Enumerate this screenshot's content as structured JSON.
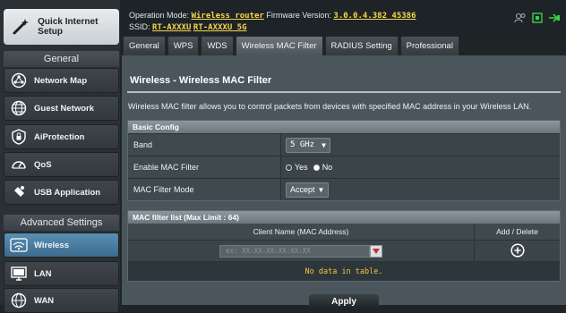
{
  "sidebar": {
    "quick_setup": "Quick Internet Setup",
    "general_label": "General",
    "general_items": [
      {
        "label": "Network Map",
        "icon": "network-map-icon"
      },
      {
        "label": "Guest Network",
        "icon": "guest-network-icon"
      },
      {
        "label": "AiProtection",
        "icon": "shield-lock-icon"
      },
      {
        "label": "QoS",
        "icon": "speedometer-icon"
      },
      {
        "label": "USB Application",
        "icon": "puzzle-icon"
      }
    ],
    "advanced_label": "Advanced Settings",
    "advanced_items": [
      {
        "label": "Wireless",
        "icon": "wifi-icon",
        "active": true
      },
      {
        "label": "LAN",
        "icon": "monitor-icon"
      },
      {
        "label": "WAN",
        "icon": "globe-icon"
      }
    ]
  },
  "header": {
    "op_mode_label": "Operation Mode:",
    "op_mode_value": "Wireless router",
    "fw_label": "Firmware Version:",
    "fw_value": "3.0.0.4.382_45386",
    "ssid_label": "SSID:",
    "ssid_1": "RT-AXXXU",
    "ssid_2": "RT-AXXXU_5G",
    "status_icons": [
      "user-group-icon",
      "usb-icon",
      "network-status-icon"
    ]
  },
  "tabs": [
    {
      "label": "General"
    },
    {
      "label": "WPS"
    },
    {
      "label": "WDS"
    },
    {
      "label": "Wireless MAC Filter",
      "active": true
    },
    {
      "label": "RADIUS Setting"
    },
    {
      "label": "Professional"
    }
  ],
  "main": {
    "title": "Wireless - Wireless MAC Filter",
    "description": "Wireless MAC filter allows you to control packets from devices with specified MAC address in your Wireless LAN.",
    "basic_config": {
      "header": "Basic Config",
      "band_label": "Band",
      "band_value": "5 GHz",
      "enable_label": "Enable MAC Filter",
      "yes_label": "Yes",
      "no_label": "No",
      "enable_value": "No",
      "mode_label": "MAC Filter Mode",
      "mode_value": "Accept"
    },
    "mac_list": {
      "header": "MAC filter list (Max Limit : 64)",
      "col_client": "Client Name (MAC Address)",
      "col_action": "Add / Delete",
      "placeholder": "ex: XX:XX:XX:XX:XX:XX",
      "empty_text": "No data in table."
    },
    "apply_label": "Apply"
  },
  "colors": {
    "accent_active_nav": "#4a7da2",
    "highlight_text": "#f8d64c",
    "status_green": "#3ad14a",
    "dropdown_red": "#d6282b"
  }
}
